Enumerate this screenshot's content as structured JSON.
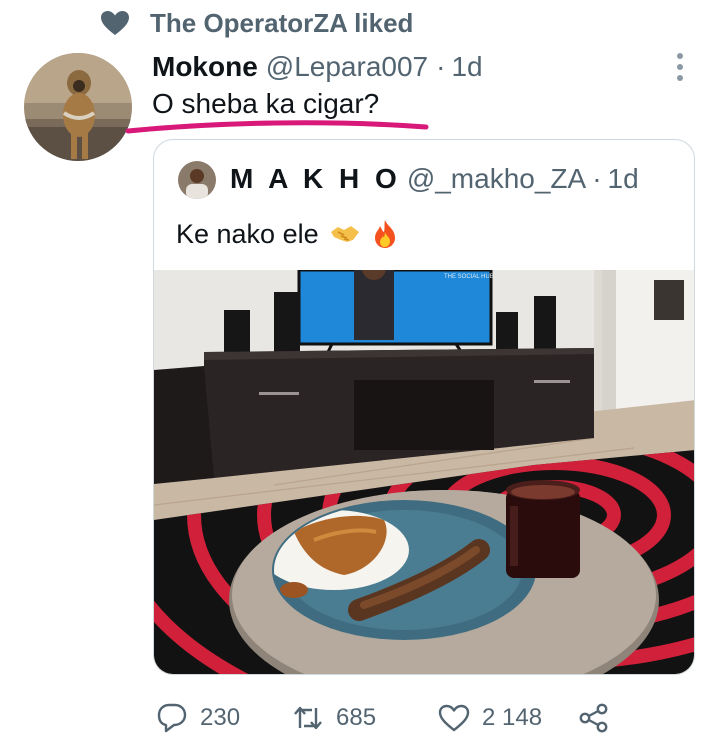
{
  "social_context": {
    "text": "The OperatorZA liked",
    "icon": "heart-icon"
  },
  "tweet": {
    "author_name": "Mokone",
    "author_handle": "@Lepara007",
    "separator": "·",
    "time": "1d",
    "text": "O sheba ka cigar?",
    "more_icon": "more-icon"
  },
  "quoted_tweet": {
    "author_name": "M A K H O",
    "author_handle": "@_makho_ZA",
    "separator": "·",
    "time": "1d",
    "text": "Ke nako ele",
    "emojis": [
      "handshake-emoji",
      "fire-emoji"
    ],
    "tv_caption": "THE SOCIAL HUB"
  },
  "actions": {
    "reply": {
      "icon": "reply-icon",
      "count": "230"
    },
    "retweet": {
      "icon": "retweet-icon",
      "count": "685"
    },
    "like": {
      "icon": "like-icon",
      "count": "2 148"
    },
    "share": {
      "icon": "share-icon"
    }
  },
  "colors": {
    "text": "#0f1419",
    "secondary": "#536471",
    "border": "#cfd9de",
    "highlight": "#d8197a"
  }
}
